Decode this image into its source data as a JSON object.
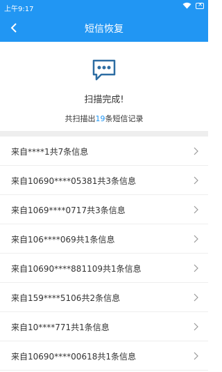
{
  "status_bar": {
    "time": "上午9:17",
    "icons": [
      "wifi-icon",
      "battery-icon"
    ]
  },
  "app_bar": {
    "title": "短信恢复",
    "back_icon": "back-arrow-icon",
    "color": "#2196f3"
  },
  "summary": {
    "icon": "message-bubble-icon",
    "title": "扫描完成!",
    "sub_prefix": "共扫描出",
    "sub_count": "19",
    "sub_suffix": "条短信记录"
  },
  "list": {
    "items": [
      {
        "label": "来自****1共7条信息"
      },
      {
        "label": "来自10690****05381共3条信息"
      },
      {
        "label": "来自1069****0717共3条信息"
      },
      {
        "label": "来自106****069共1条信息"
      },
      {
        "label": "来自10690****881109共1条信息"
      },
      {
        "label": "来自159****5106共2条信息"
      },
      {
        "label": "来自10****771共1条信息"
      },
      {
        "label": "来自10690****00618共1条信息"
      }
    ]
  }
}
